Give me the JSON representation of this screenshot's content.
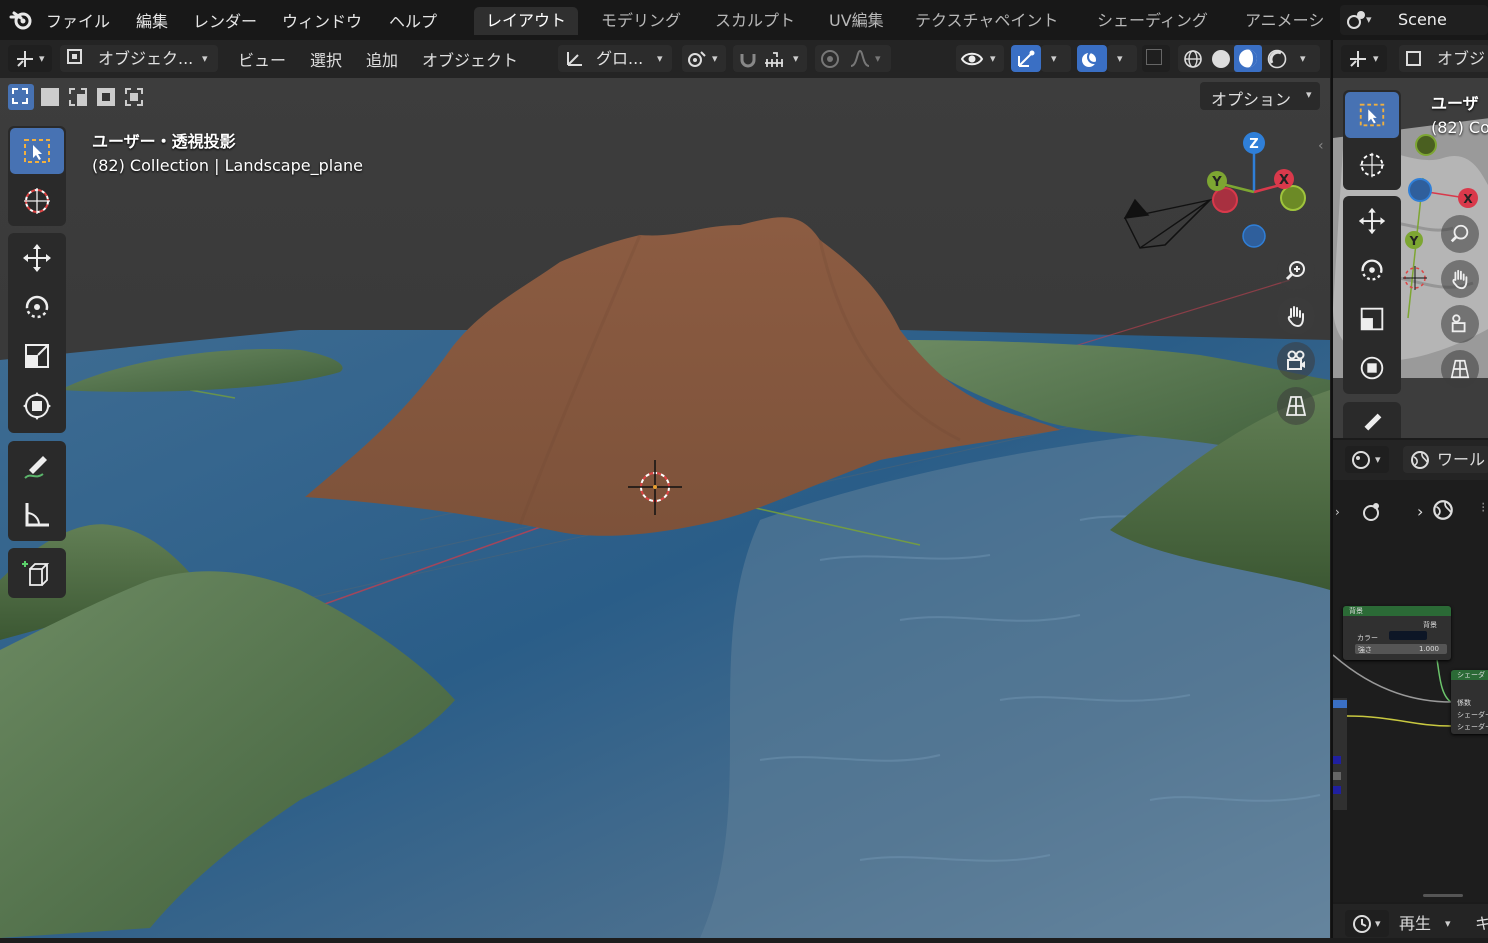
{
  "menu": {
    "items": [
      "ファイル",
      "編集",
      "レンダー",
      "ウィンドウ",
      "ヘルプ"
    ]
  },
  "workspaces": {
    "tabs": [
      "レイアウト",
      "モデリング",
      "スカルプト",
      "UV編集",
      "テクスチャペイント",
      "シェーディング",
      "アニメーシ"
    ],
    "active": "レイアウト"
  },
  "scene": {
    "name": "Scene"
  },
  "viewport_header": {
    "mode_label": "オブジェク...",
    "view": "ビュー",
    "select": "選択",
    "add": "追加",
    "object": "オブジェクト",
    "transform_orientation": "グロ..."
  },
  "options_label": "オプション",
  "viewport_overlay": {
    "view_name": "ユーザー・透視投影",
    "collection_info": "(82) Collection | Landscape_plane"
  },
  "gizmo": {
    "z": "Z",
    "y": "Y",
    "x": "X"
  },
  "right_viewport": {
    "mode_label": "オブジ",
    "view_name": "ユーザ",
    "collection_info": "(82) Co",
    "gizmo_x": "X",
    "gizmo_y": "Y"
  },
  "shader_editor": {
    "world_label": "ワール",
    "node_background": {
      "title": "背景",
      "output": "背景",
      "color_label": "カラー",
      "strength_label": "強さ",
      "strength_value": "1.000"
    },
    "node_shader_mix": {
      "title": "シェーダ",
      "inputs": [
        "係数",
        "シェーダー",
        "シェーダー"
      ]
    }
  },
  "timeline": {
    "play_label": "再生",
    "key_label": "キ"
  },
  "colors": {
    "accent": "#4772b3",
    "active_tab": "#2f2f2f",
    "axis_x": "#d9394b",
    "axis_y": "#7da632",
    "axis_z": "#2f7fd8",
    "mountain": "#83563d",
    "water": "#2d5f86"
  }
}
